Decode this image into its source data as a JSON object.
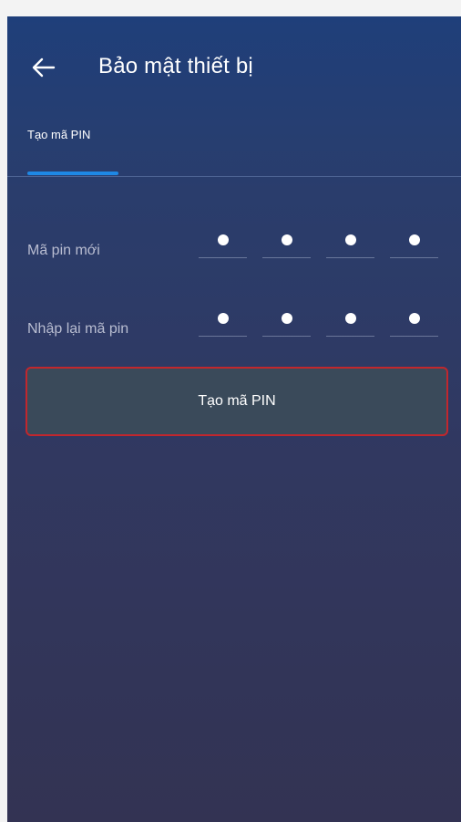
{
  "header": {
    "title": "Bảo mật thiết bị",
    "back_icon": "arrow-left-icon"
  },
  "tabs": [
    {
      "label": "Tạo mã PIN",
      "active": true
    }
  ],
  "form": {
    "new_pin": {
      "label": "Mã pin mới",
      "filled_digits": 4,
      "length": 4
    },
    "confirm_pin": {
      "label": "Nhập lại mã pin",
      "filled_digits": 4,
      "length": 4
    }
  },
  "actions": {
    "create_label": "Tạo mã PIN"
  },
  "colors": {
    "background_top": "#1f3f7a",
    "background_bottom": "#333353",
    "tab_indicator": "#1e88e5",
    "button_background": "#3a4a5a",
    "button_border": "#c1272d",
    "muted_label": "#b9bdd1"
  }
}
